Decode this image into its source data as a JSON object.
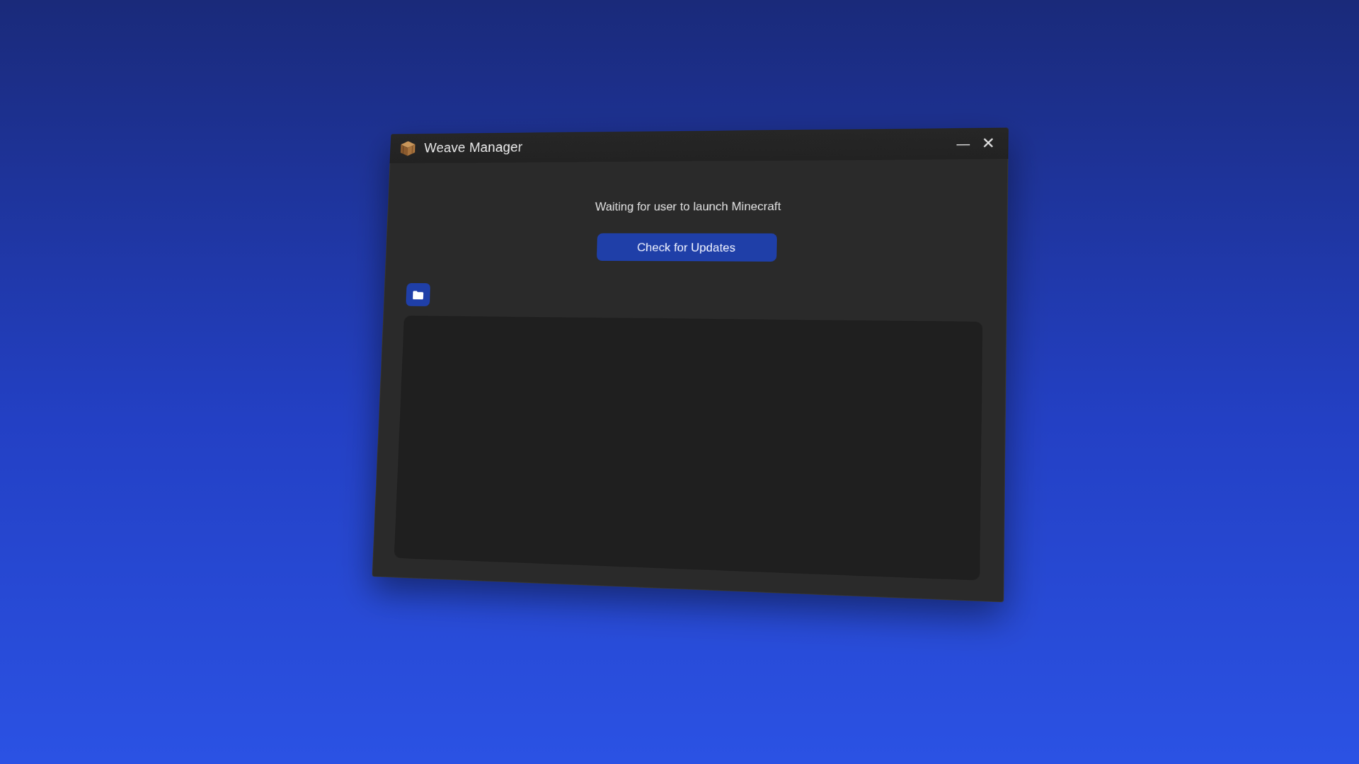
{
  "window": {
    "title": "Weave Manager",
    "app_icon": "crafting-table-icon",
    "controls": {
      "minimize": "—",
      "close": "✕"
    }
  },
  "main": {
    "status_text": "Waiting for user to launch Minecraft",
    "update_button_label": "Check for Updates",
    "folder_button_icon": "folder-icon"
  },
  "colors": {
    "accent": "#1f3fa8",
    "window_bg": "#2a2a2a",
    "panel_bg": "#1f1f1f",
    "desktop_top": "#1a2a7a",
    "desktop_bottom": "#2b52e4"
  }
}
